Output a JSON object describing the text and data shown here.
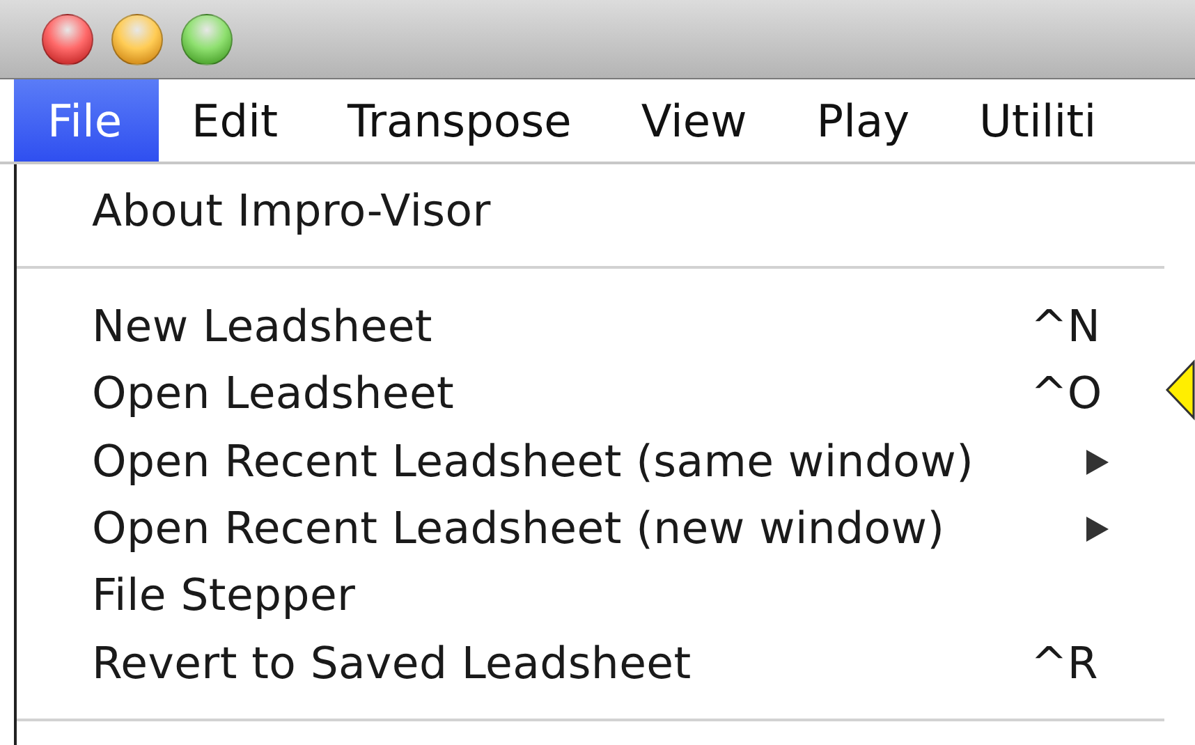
{
  "menubar": [
    {
      "label": "File",
      "selected": true
    },
    {
      "label": "Edit",
      "selected": false
    },
    {
      "label": "Transpose",
      "selected": false
    },
    {
      "label": "View",
      "selected": false
    },
    {
      "label": "Play",
      "selected": false
    },
    {
      "label": "Utiliti",
      "selected": false
    }
  ],
  "menu": {
    "groups": [
      [
        {
          "label": "About Impro-Visor",
          "submenu": false
        }
      ],
      [
        {
          "label": "New Leadsheet",
          "shortcut": "^N",
          "submenu": false
        },
        {
          "label": "Open Leadsheet",
          "shortcut": "^O",
          "submenu": false
        },
        {
          "label": "Open Recent Leadsheet (same window)",
          "submenu": true
        },
        {
          "label": "Open Recent Leadsheet (new window)",
          "submenu": true
        },
        {
          "label": "File Stepper",
          "submenu": false
        },
        {
          "label": "Revert to Saved Leadsheet",
          "shortcut": "^R",
          "submenu": false
        }
      ]
    ]
  }
}
